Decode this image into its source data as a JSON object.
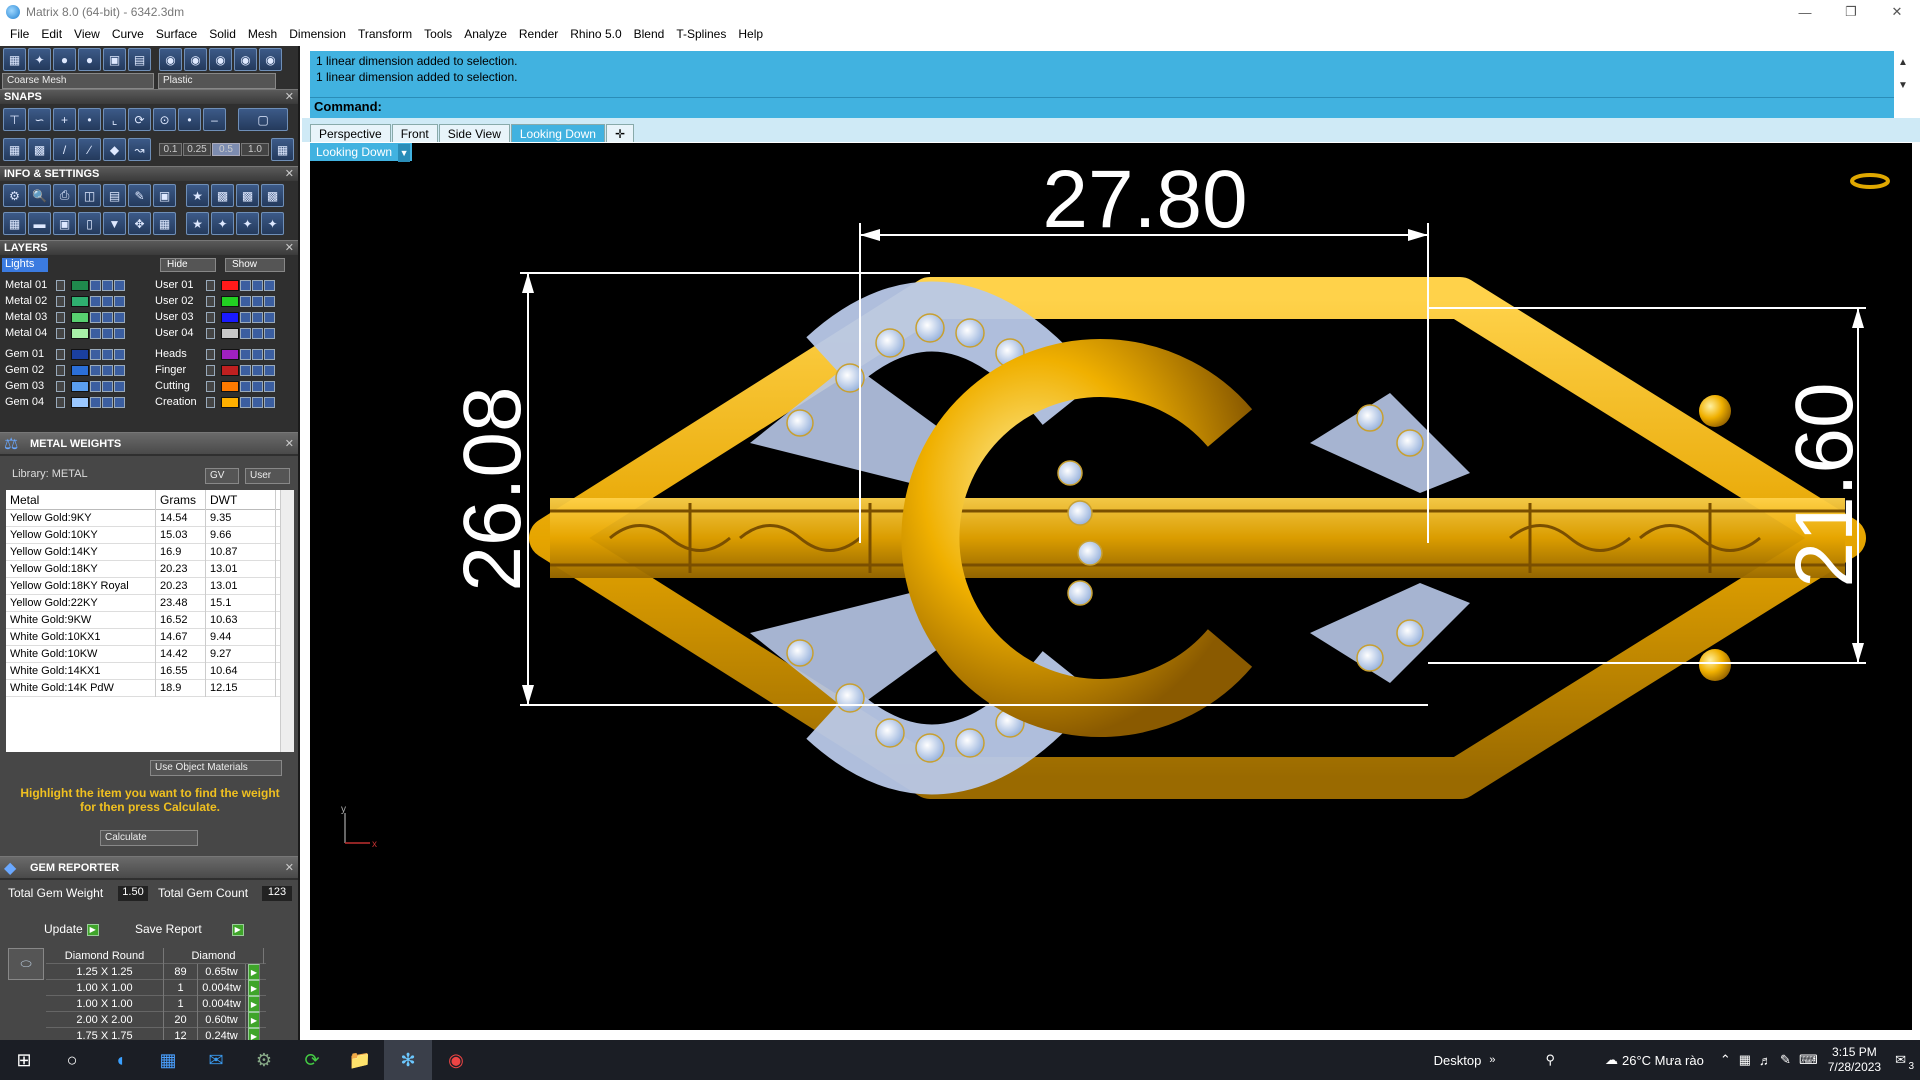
{
  "window": {
    "title": "Matrix 8.0 (64-bit) - 6342.3dm"
  },
  "menu": [
    "File",
    "Edit",
    "View",
    "Curve",
    "Surface",
    "Solid",
    "Mesh",
    "Dimension",
    "Transform",
    "Tools",
    "Analyze",
    "Render",
    "Rhino 5.0",
    "Blend",
    "T-Splines",
    "Help"
  ],
  "left": {
    "top_dropdowns": {
      "mesh": "Coarse Mesh",
      "material": "Plastic"
    },
    "snaps_title": "SNAPS",
    "snap_values": [
      "0.1",
      "0.25",
      "0.5",
      "1.0"
    ],
    "info_title": "INFO & SETTINGS",
    "layers_title": "LAYERS",
    "layers_header": {
      "lights": "Lights",
      "hide": "Hide",
      "show": "Show"
    },
    "layers_left": [
      {
        "name": "Metal 01",
        "color": "#1f8a4c"
      },
      {
        "name": "Metal 02",
        "color": "#2fb070"
      },
      {
        "name": "Metal 03",
        "color": "#58d070"
      },
      {
        "name": "Metal 04",
        "color": "#a8f0a8"
      },
      {
        "name": "Gem 01",
        "color": "#1a3fa0"
      },
      {
        "name": "Gem 02",
        "color": "#2b6fd8"
      },
      {
        "name": "Gem 03",
        "color": "#5b9ff0"
      },
      {
        "name": "Gem 04",
        "color": "#9bc8ff"
      }
    ],
    "layers_right": [
      {
        "name": "User 01",
        "color": "#ff1a1a"
      },
      {
        "name": "User 02",
        "color": "#22d022"
      },
      {
        "name": "User 03",
        "color": "#1a1aff"
      },
      {
        "name": "User 04",
        "color": "#c8c8c8"
      },
      {
        "name": "Heads",
        "color": "#a020c0"
      },
      {
        "name": "Finger",
        "color": "#c02020"
      },
      {
        "name": "Cutting",
        "color": "#ff7a00"
      },
      {
        "name": "Creation",
        "color": "#ffb000"
      }
    ],
    "metal_weights": {
      "title": "METAL WEIGHTS",
      "library": "Library: METAL",
      "gv": "GV",
      "user": "User",
      "headers": [
        "Metal",
        "Grams",
        "DWT"
      ],
      "rows": [
        [
          "Yellow Gold:9KY",
          "14.54",
          "9.35"
        ],
        [
          "Yellow Gold:10KY",
          "15.03",
          "9.66"
        ],
        [
          "Yellow Gold:14KY",
          "16.9",
          "10.87"
        ],
        [
          "Yellow Gold:18KY",
          "20.23",
          "13.01"
        ],
        [
          "Yellow Gold:18KY Royal",
          "20.23",
          "13.01"
        ],
        [
          "Yellow Gold:22KY",
          "23.48",
          "15.1"
        ],
        [
          "White Gold:9KW",
          "16.52",
          "10.63"
        ],
        [
          "White Gold:10KX1",
          "14.67",
          "9.44"
        ],
        [
          "White Gold:10KW",
          "14.42",
          "9.27"
        ],
        [
          "White Gold:14KX1",
          "16.55",
          "10.64"
        ],
        [
          "White Gold:14K PdW",
          "18.9",
          "12.15"
        ]
      ],
      "use_object_materials": "Use Object Materials",
      "hint": "Highlight the item you want to find the weight for then press Calculate.",
      "calculate": "Calculate"
    },
    "gem_reporter": {
      "title": "GEM REPORTER",
      "total_weight_label": "Total Gem Weight",
      "total_weight": "1.50",
      "total_count_label": "Total Gem Count",
      "total_count": "123",
      "update": "Update",
      "save_report": "Save Report",
      "headers": [
        "Diamond Round",
        "Diamond"
      ],
      "rows": [
        [
          "1.25 X 1.25",
          "89",
          "0.65tw"
        ],
        [
          "1.00 X 1.00",
          "1",
          "0.004tw"
        ],
        [
          "1.00 X 1.00",
          "1",
          "0.004tw"
        ],
        [
          "2.00 X 2.00",
          "20",
          "0.60tw"
        ],
        [
          "1.75 X 1.75",
          "12",
          "0.24tw"
        ]
      ]
    }
  },
  "command": {
    "history": [
      "1 linear dimension added to selection.",
      "1 linear dimension added to selection."
    ],
    "prompt": "Command:"
  },
  "viewtabs": [
    "Perspective",
    "Front",
    "Side View",
    "Looking Down"
  ],
  "active_view": "Looking Down",
  "viewport": {
    "dimensions": {
      "top": "27.80",
      "left": "26.08",
      "right": "21.60"
    },
    "axis_y": "y",
    "axis_x": "x"
  },
  "taskbar": {
    "desktop": "Desktop",
    "weather": "26°C  Mưa rào",
    "time": "3:15 PM",
    "date": "7/28/2023",
    "notifications": "3"
  }
}
